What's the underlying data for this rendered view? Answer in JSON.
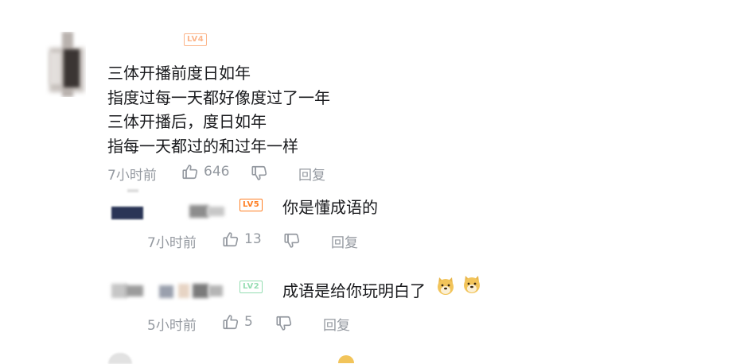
{
  "main_comment": {
    "level": "LV4",
    "level_color": "#fcb58a",
    "lines": [
      "三体开播前度日如年",
      "指度过每一天都好像度过了一年",
      "三体开播后，度日如年",
      "指每一天都过的和过年一样"
    ],
    "time": "7小时前",
    "likes": "646",
    "reply_label": "回复"
  },
  "replies": [
    {
      "level": "LV5",
      "level_color": "#ff7f24",
      "text": "你是懂成语的",
      "time": "7小时前",
      "likes": "13",
      "reply_label": "回复"
    },
    {
      "level": "LV2",
      "level_color": "#95ddb2",
      "text": "成语是给你玩明白了",
      "emojis": [
        "doge-emoji",
        "doge-emoji"
      ],
      "time": "5小时前",
      "likes": "5",
      "reply_label": "回复"
    }
  ],
  "colors": {
    "text": "#18191c",
    "meta": "#9499a0"
  }
}
